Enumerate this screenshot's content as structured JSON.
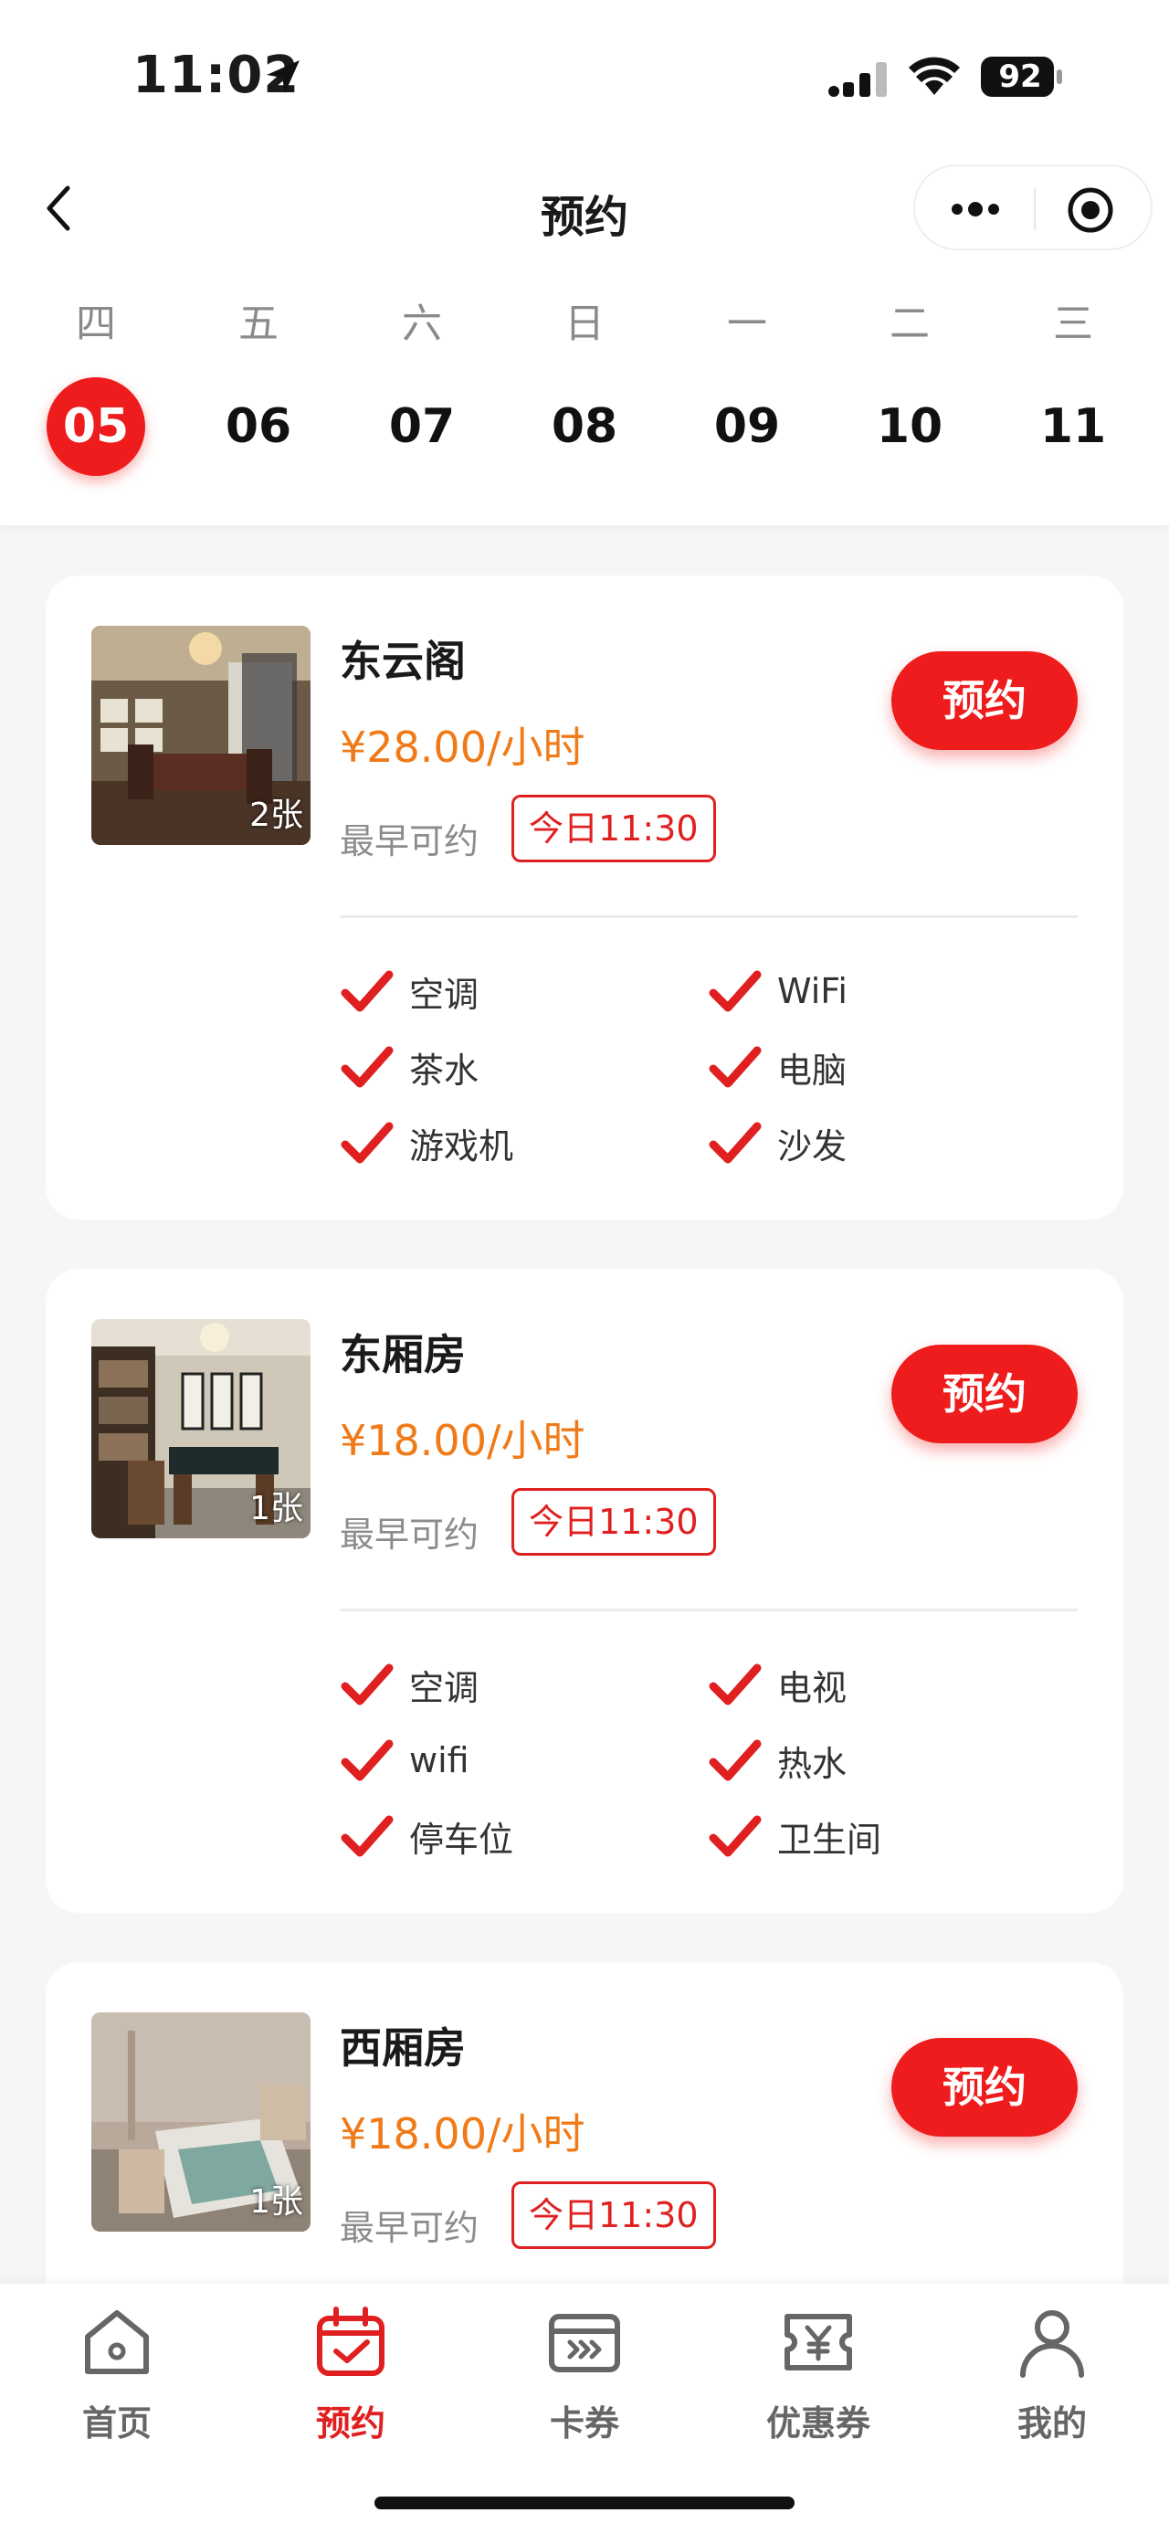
{
  "status_bar": {
    "time": "11:02",
    "battery": "92"
  },
  "nav": {
    "title": "预约"
  },
  "date_strip": {
    "days": [
      {
        "weekday": "四",
        "date": "05",
        "selected": true
      },
      {
        "weekday": "五",
        "date": "06"
      },
      {
        "weekday": "六",
        "date": "07"
      },
      {
        "weekday": "日",
        "date": "08"
      },
      {
        "weekday": "一",
        "date": "09"
      },
      {
        "weekday": "二",
        "date": "10"
      },
      {
        "weekday": "三",
        "date": "11"
      }
    ]
  },
  "rooms": [
    {
      "name": "东云阁",
      "price": "¥28.00/小时",
      "count": "2张",
      "earliest_label": "最早可约",
      "earliest_time": "今日11:30",
      "book_label": "预约",
      "features": [
        "空调",
        "WiFi",
        "茶水",
        "电脑",
        "游戏机",
        "沙发"
      ]
    },
    {
      "name": "东厢房",
      "price": "¥18.00/小时",
      "count": "1张",
      "earliest_label": "最早可约",
      "earliest_time": "今日11:30",
      "book_label": "预约",
      "features": [
        "空调",
        "电视",
        "wifi",
        "热水",
        "停车位",
        "卫生间"
      ]
    },
    {
      "name": "西厢房",
      "price": "¥18.00/小时",
      "count": "1张",
      "earliest_label": "最早可约",
      "earliest_time": "今日11:30",
      "book_label": "预约"
    }
  ],
  "tab_bar": {
    "tabs": [
      {
        "label": "首页",
        "icon": "home-icon"
      },
      {
        "label": "预约",
        "icon": "calendar-check-icon",
        "active": true
      },
      {
        "label": "卡券",
        "icon": "card-icon"
      },
      {
        "label": "优惠券",
        "icon": "coupon-icon"
      },
      {
        "label": "我的",
        "icon": "user-icon"
      }
    ]
  },
  "colors": {
    "accent": "#ee1c1c",
    "price": "#f07a18",
    "muted": "#8c8c8c"
  }
}
